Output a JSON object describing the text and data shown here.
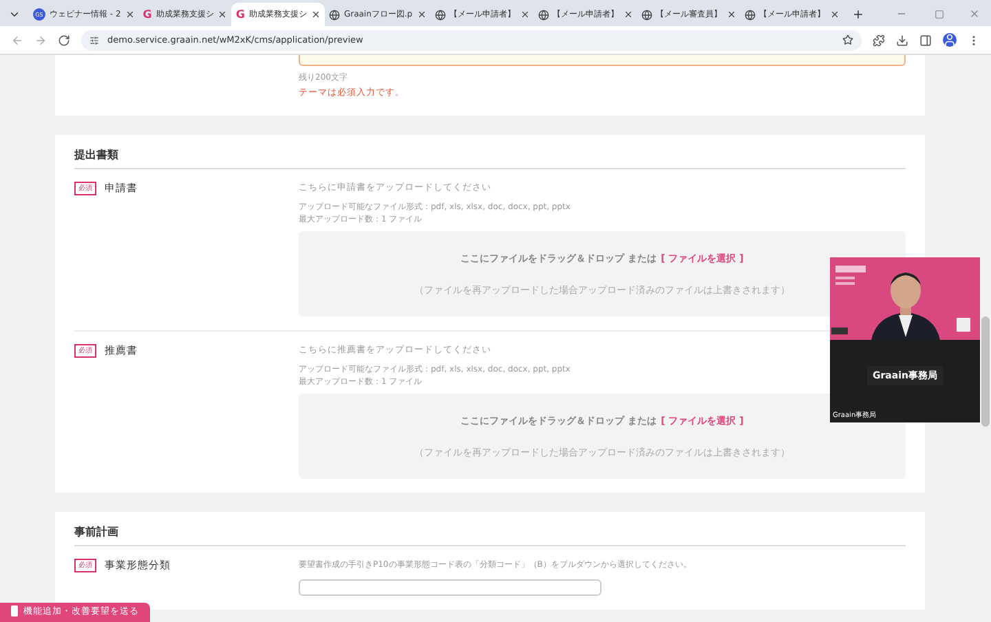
{
  "browser": {
    "tabs": [
      {
        "label": "ウェビナー情報 - 2",
        "kind": "badge",
        "icon_text": "GS",
        "selected": false
      },
      {
        "label": "助成業務支援シ",
        "kind": "letter",
        "icon_text": "G",
        "selected": false
      },
      {
        "label": "助成業務支援シ",
        "kind": "letter",
        "icon_text": "G",
        "selected": true
      },
      {
        "label": "Graainフロー図.p",
        "kind": "web",
        "selected": false
      },
      {
        "label": "【メール申請者】",
        "kind": "web",
        "selected": false
      },
      {
        "label": "【メール申請者】",
        "kind": "web",
        "selected": false
      },
      {
        "label": "【メール審査員】",
        "kind": "web",
        "selected": false
      },
      {
        "label": "【メール申請者】",
        "kind": "web",
        "selected": false
      }
    ],
    "url": "demo.service.graain.net/wM2xK/cms/application/preview"
  },
  "theme_section": {
    "remaining": "残り200文字",
    "error": "テーマは必須入力です。"
  },
  "documents_section": {
    "title": "提出書類",
    "items": [
      {
        "required": "必須",
        "label": "申請書",
        "instruction": "こちらに申請書をアップロードしてください",
        "formats": "アップロード可能なファイル形式：pdf, xls, xlsx, doc, docx, ppt, pptx",
        "max": "最大アップロード数：1 ファイル",
        "drop_text": "ここにファイルをドラッグ＆ドロップ または",
        "select_link": "[ ファイルを選択 ]",
        "note": "（ファイルを再アップロードした場合アップロード済みのファイルは上書きされます）"
      },
      {
        "required": "必須",
        "label": "推薦書",
        "instruction": "こちらに推薦書をアップロードしてください",
        "formats": "アップロード可能なファイル形式：pdf, xls, xlsx, doc, docx, ppt, pptx",
        "max": "最大アップロード数：1 ファイル",
        "drop_text": "ここにファイルをドラッグ＆ドロップ または",
        "select_link": "[ ファイルを選択 ]",
        "note": "（ファイルを再アップロードした場合アップロード済みのファイルは上書きされます）"
      }
    ]
  },
  "plan_section": {
    "title": "事前計画",
    "items": [
      {
        "required": "必須",
        "label": "事業形態分類",
        "instruction": "要望書作成の手引きP10の事業形態コード表の「分類コード」（B）をプルダウンから選択してください。"
      }
    ]
  },
  "video": {
    "center_label": "Graain事務局",
    "name_tag": "Graain事務局"
  },
  "feedback_button": "機能追加・改善要望を送る"
}
